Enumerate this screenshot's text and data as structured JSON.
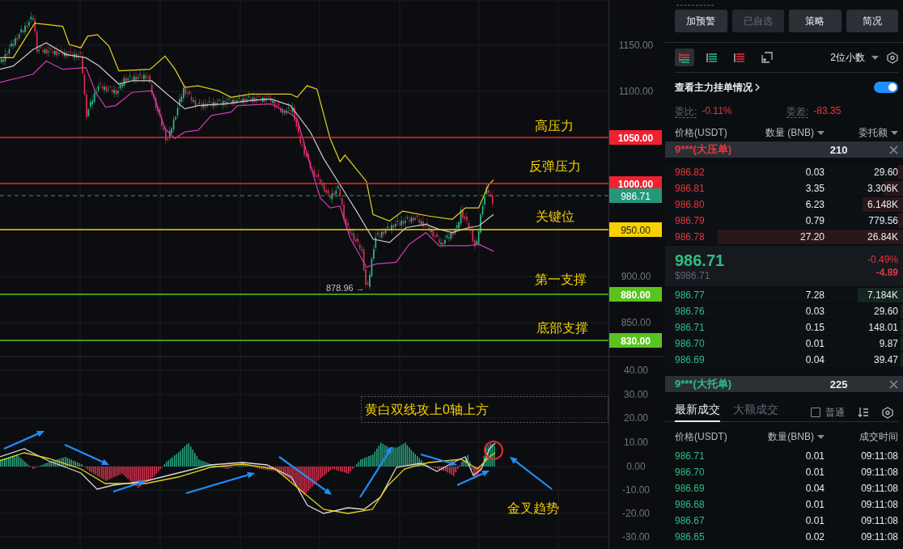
{
  "chart": {
    "price_axis": [
      "1150.00",
      "1100.00",
      "900.00",
      "850.00"
    ],
    "levels": [
      {
        "label": "高压力",
        "price": "1050.00",
        "color": "#f0212f"
      },
      {
        "label": "反弹压力",
        "price": "1000.00",
        "color": "#f0212f"
      },
      {
        "label": "关键位",
        "price": "950.00",
        "color": "#f8d200"
      },
      {
        "label": "第一支撑",
        "price": "880.00",
        "color": "#5ac41f"
      },
      {
        "label": "底部支撑",
        "price": "830.00",
        "color": "#5ac41f"
      }
    ],
    "last_price": "986.71",
    "low_marker": "878.96 →"
  },
  "indicator": {
    "axis": [
      "40.00",
      "30.00",
      "20.00",
      "10.00",
      "0.00",
      "-10.00",
      "-20.00",
      "-30.00"
    ],
    "note": "黄白双线攻上0轴上方",
    "trend_label": "金叉趋势"
  },
  "panel": {
    "buttons": [
      {
        "label": "加预警",
        "disabled": false
      },
      {
        "label": "已自选",
        "disabled": true
      },
      {
        "label": "策略",
        "disabled": false
      },
      {
        "label": "简况",
        "disabled": false
      }
    ],
    "view_modes": [
      {
        "kind": "both",
        "selected": true
      },
      {
        "kind": "bids",
        "selected": false
      },
      {
        "kind": "asks",
        "selected": false
      },
      {
        "kind": "add",
        "selected": false
      }
    ],
    "precision": "2位小数",
    "depth_toggle": {
      "label": "查看主力挂单情况",
      "on": true
    },
    "ratio": {
      "label": "委比:",
      "value": "-0.11%"
    },
    "diff": {
      "label": "委差:",
      "value": "-83.35"
    },
    "book_columns": [
      {
        "label": "价格(USDT)",
        "dropdown": false
      },
      {
        "label": "数量 (BNB)",
        "dropdown": true
      },
      {
        "label": "委托额",
        "dropdown": true
      }
    ],
    "big_ask": {
      "label": "9***(大压单)",
      "value": "210"
    },
    "asks": [
      {
        "price": "986.82",
        "amount": "0.03",
        "total": "29.60",
        "level": 0.02
      },
      {
        "price": "986.81",
        "amount": "3.35",
        "total": "3.306K",
        "level": 0.08
      },
      {
        "price": "986.80",
        "amount": "6.23",
        "total": "6.148K",
        "level": 0.17
      },
      {
        "price": "986.79",
        "amount": "0.79",
        "total": "779.56",
        "level": 0.02
      },
      {
        "price": "986.78",
        "amount": "27.20",
        "total": "26.84K",
        "level": 0.78
      }
    ],
    "last": {
      "price": "986.71",
      "usd": "$986.71",
      "change_pct": "-0.49%",
      "change": "-4.89"
    },
    "bids": [
      {
        "price": "986.77",
        "amount": "7.28",
        "total": "7.184K",
        "level": 0.19
      },
      {
        "price": "986.76",
        "amount": "0.03",
        "total": "29.60",
        "level": 0.01
      },
      {
        "price": "986.71",
        "amount": "0.15",
        "total": "148.01",
        "level": 0.01
      },
      {
        "price": "986.70",
        "amount": "0.01",
        "total": "9.87",
        "level": 0.01
      },
      {
        "price": "986.69",
        "amount": "0.04",
        "total": "39.47",
        "level": 0.01
      }
    ],
    "big_bid": {
      "label": "9***(大托单)",
      "value": "225"
    },
    "trade_tabs": [
      {
        "label": "最新成交",
        "selected": true
      },
      {
        "label": "大额成交",
        "selected": false
      }
    ],
    "normal_filter": {
      "label": "普通",
      "checked": false
    },
    "trade_columns": [
      {
        "label": "价格(USDT)",
        "dropdown": false
      },
      {
        "label": "数量(BNB)",
        "dropdown": true
      },
      {
        "label": "成交时间",
        "dropdown": false
      }
    ],
    "trades": [
      {
        "price": "986.71",
        "amount": "0.01",
        "time": "09:11:08"
      },
      {
        "price": "986.70",
        "amount": "0.01",
        "time": "09:11:08"
      },
      {
        "price": "986.69",
        "amount": "0.04",
        "time": "09:11:08"
      },
      {
        "price": "986.68",
        "amount": "0.01",
        "time": "09:11:08"
      },
      {
        "price": "986.67",
        "amount": "0.01",
        "time": "09:11:08"
      },
      {
        "price": "986.65",
        "amount": "0.02",
        "time": "09:11:08"
      }
    ]
  }
}
